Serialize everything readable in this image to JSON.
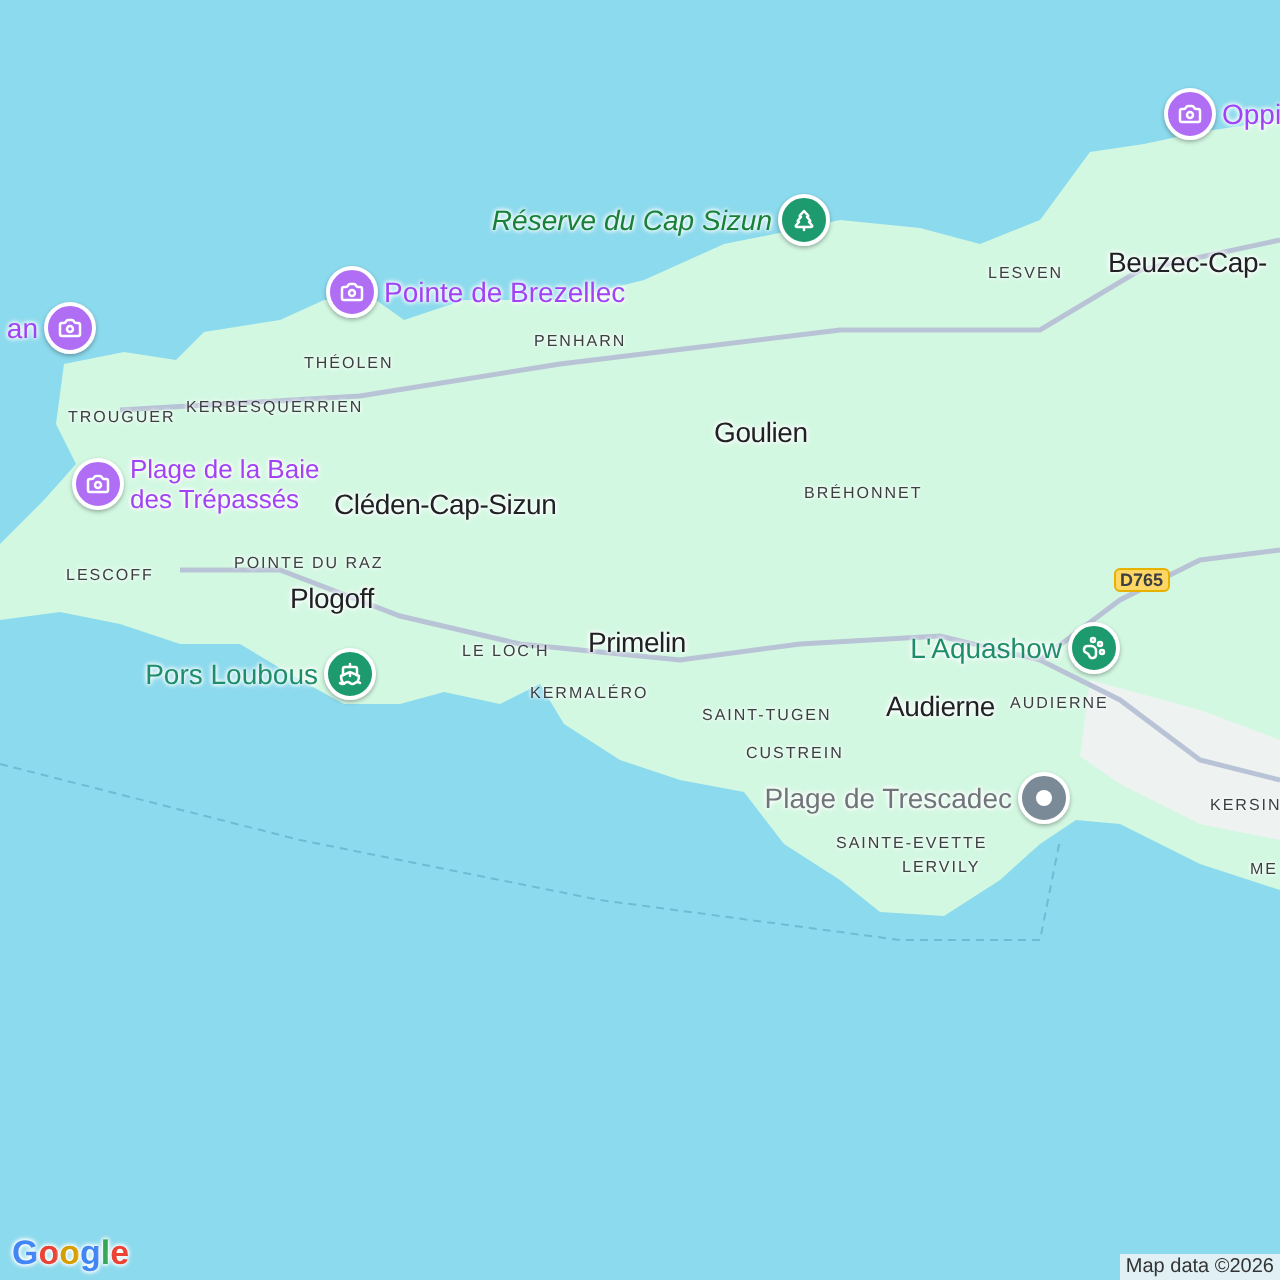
{
  "map": {
    "labels": [
      {
        "kind": "sightseeing",
        "text": "an"
      },
      {
        "kind": "sightseeing",
        "text": "Oppi"
      },
      {
        "kind": "park",
        "text": "Réserve du Cap Sizun"
      },
      {
        "kind": "sightseeing",
        "text": "Pointe de Brezellec"
      },
      {
        "kind": "town",
        "text": "Beuzec-Cap-"
      },
      {
        "kind": "hamlet",
        "text": "LESVEN"
      },
      {
        "kind": "hamlet",
        "text": "THÉOLEN"
      },
      {
        "kind": "hamlet",
        "text": "PENHARN"
      },
      {
        "kind": "hamlet",
        "text": "TROUGUER"
      },
      {
        "kind": "hamlet",
        "text": "KERBESQUERRIEN"
      },
      {
        "kind": "town",
        "text": "Goulien"
      },
      {
        "kind": "sightseeing",
        "text": "Plage de la Baie des Trépassés"
      },
      {
        "kind": "town",
        "text": "Cléden-Cap-Sizun"
      },
      {
        "kind": "hamlet",
        "text": "BRÉHONNET"
      },
      {
        "kind": "hamlet",
        "text": "LESCOFF"
      },
      {
        "kind": "hamlet",
        "text": "POINTE DU RAZ"
      },
      {
        "kind": "town",
        "text": "Plogoff"
      },
      {
        "kind": "town",
        "text": "Primelin"
      },
      {
        "kind": "ferry",
        "text": "Pors Loubous"
      },
      {
        "kind": "hamlet",
        "text": "LE LOC'H"
      },
      {
        "kind": "zoo",
        "text": "L'Aquashow"
      },
      {
        "kind": "hamlet",
        "text": "KERMALÉRO"
      },
      {
        "kind": "town",
        "text": "Audierne"
      },
      {
        "kind": "hamlet",
        "text": "AUDIERNE"
      },
      {
        "kind": "hamlet",
        "text": "SAINT-TUGEN"
      },
      {
        "kind": "hamlet",
        "text": "CUSTREIN"
      },
      {
        "kind": "beach",
        "text": "Plage de Trescadec"
      },
      {
        "kind": "hamlet",
        "text": "KERSIN"
      },
      {
        "kind": "hamlet",
        "text": "SAINTE-EVETTE"
      },
      {
        "kind": "hamlet",
        "text": "LERVILY"
      },
      {
        "kind": "hamlet",
        "text": "ME"
      }
    ],
    "road_shields": [
      {
        "text": "D765"
      }
    ]
  },
  "logo": "Google",
  "attribution": "Map data ©2026"
}
